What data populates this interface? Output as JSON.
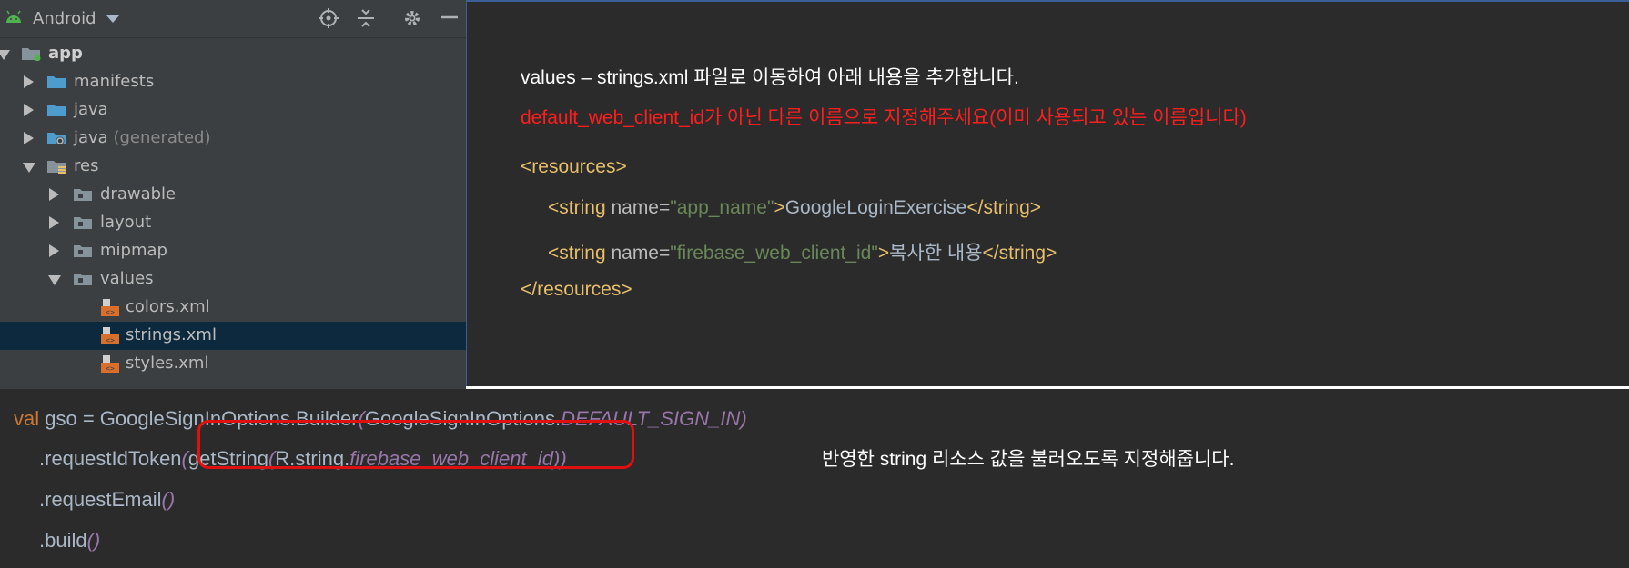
{
  "project_panel": {
    "title": "Android",
    "toolbar": [
      "locate-icon",
      "collapse-all-icon",
      "settings-icon",
      "hide-icon"
    ],
    "tree": [
      {
        "label": "app",
        "icon": "module-folder-icon",
        "state": "expanded"
      },
      {
        "label": "manifests",
        "icon": "folder-icon",
        "state": "collapsed"
      },
      {
        "label": "java",
        "icon": "folder-icon",
        "state": "collapsed"
      },
      {
        "label": "java",
        "suffix": "(generated)",
        "icon": "generated-folder-icon",
        "state": "collapsed"
      },
      {
        "label": "res",
        "icon": "resources-folder-icon",
        "state": "expanded"
      },
      {
        "label": "drawable",
        "icon": "folder-icon",
        "state": "collapsed"
      },
      {
        "label": "layout",
        "icon": "folder-icon",
        "state": "collapsed"
      },
      {
        "label": "mipmap",
        "icon": "folder-icon",
        "state": "collapsed"
      },
      {
        "label": "values",
        "icon": "folder-icon",
        "state": "expanded"
      },
      {
        "label": "colors.xml",
        "icon": "xml-file-icon"
      },
      {
        "label": "strings.xml",
        "icon": "xml-file-icon",
        "selected": true
      },
      {
        "label": "styles.xml",
        "icon": "xml-file-icon"
      }
    ]
  },
  "instructions": {
    "line1": "values – strings.xml 파일로 이동하여 아래 내용을 추가합니다.",
    "line2": "default_web_client_id가 아닌 다른 이름으로 지정해주세요(이미 사용되고 있는 이름입니다)"
  },
  "xml_snippet": {
    "open_lt": "<",
    "close_gt": ">",
    "end_lt": "</",
    "resources_tag": "resources",
    "string_tag": "string",
    "name_attr": " name=",
    "line1_value": "\"app_name\"",
    "line1_text": "GoogleLoginExercise",
    "line2_value": "\"firebase_web_client_id\"",
    "line2_text": "복사한 내용"
  },
  "kotlin_code": {
    "l1_kw": "val",
    "l1_plain": " gso = GoogleSignInOptions.Builder",
    "l1_paren_open": "(",
    "l1_plain2": "GoogleSignInOptions.",
    "l1_const": "DEFAULT_SIGN_IN",
    "l1_paren_close": ")",
    "l2_plain": ".requestIdToken",
    "l2_paren_open": "(",
    "l2_plain2": "getString",
    "l2_paren_open2": "(",
    "l2_plain3": "R.string.",
    "l2_field": "firebase_web_client_id",
    "l2_paren_close": "))",
    "l3_plain": ".requestEmail",
    "l3_parens": "()",
    "l4_plain": ".build",
    "l4_parens": "()"
  },
  "annotation": {
    "note": "반영한 string 리소스 값을 불러오도록 지정해줍니다."
  },
  "colors": {
    "panel_bg": "#3c3f41",
    "editor_bg": "#2b2b2b",
    "selection": "#0d293e",
    "keyword": "#cc7832",
    "italic_purple": "#9876aa",
    "xml_tag": "#e8bf6a",
    "xml_value": "#6a8759",
    "highlight_red": "#e01010"
  }
}
